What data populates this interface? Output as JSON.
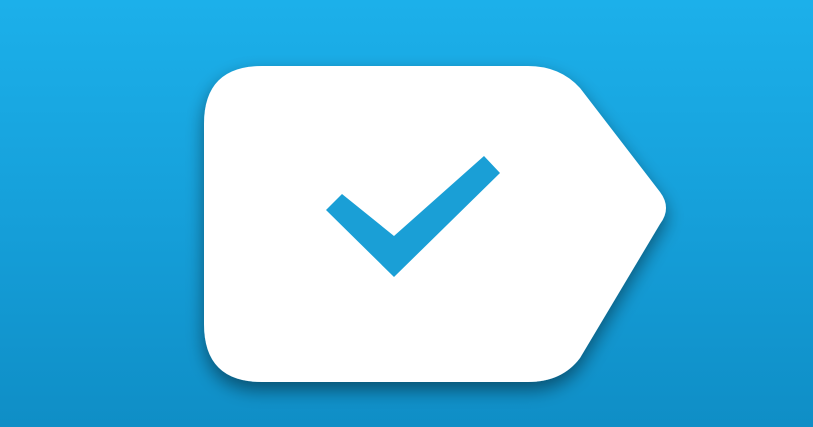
{
  "background": {
    "color_top": "#1cb0ea",
    "color_bottom": "#0f8ec6"
  },
  "logo": {
    "icon": "tag-checkmark-icon",
    "tag_color": "#ffffff",
    "check_color": "#1a9fd6",
    "shadow_color": "#0a4f75"
  }
}
